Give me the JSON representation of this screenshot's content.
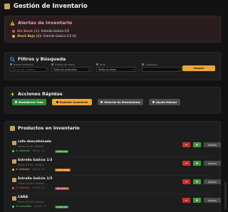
{
  "header": {
    "title": "Gestión de Inventario",
    "icon": "box-icon"
  },
  "alerts": {
    "title": "Alertas de Inventario",
    "items": [
      {
        "tag": "Sin Stock (1):",
        "text": "Estrella Galicia 1/5",
        "color": "#d9534f"
      },
      {
        "tag": "Stock Bajo (1):",
        "text": "Estrella Galicia 1/3 (4)",
        "color": "#f0ad4e"
      }
    ]
  },
  "filters": {
    "title": "Filtros y Búsqueda",
    "search_label": "Buscar producto",
    "search_placeholder": "Buscar por nombre...",
    "status_label": "Estado del stock",
    "status_value": "Todos los productos",
    "area_label": "Área",
    "area_value": "Todas las áreas",
    "category_label": "Categoría",
    "category_value": "",
    "clear_label": "Limpiar"
  },
  "actions": {
    "title": "Acciones Rápidas",
    "buttons": [
      {
        "label": "Restablecer Todo",
        "color": "#2e8b3a"
      },
      {
        "label": "Exportar Inventario",
        "color": "#f0a632"
      },
      {
        "label": "Historial de Movimientos",
        "color": "#4a4a4a"
      },
      {
        "label": "Ajuste Manual",
        "color": "#4a4a4a"
      }
    ]
  },
  "products": {
    "title": "Productos en Inventario",
    "items": [
      {
        "name": "cafe descafeinado",
        "meta": "Precio: €0.00 • Bebida",
        "stock": "0 unidades",
        "min": "Stock: 12",
        "badge": "STOCK OK",
        "badge_color": "#2e7d32",
        "minus": "−",
        "plus": "+",
        "adjust": "Ajustar"
      },
      {
        "name": "Estrella Galicia 1/3",
        "meta": "Precio: €0.00 • Alcohol",
        "stock": "4 unidades",
        "min": "Stock: 10",
        "badge": "STOCK BAJO",
        "badge_color": "#c77a00",
        "minus": "−",
        "plus": "+",
        "adjust": "Ajustar"
      },
      {
        "name": "Estrella Galicia 1/5",
        "meta": "Precio: €0.00 • Alcohol",
        "stock": "0 unidades",
        "min": "Stock: 10",
        "badge": "SIN STOCK",
        "badge_color": "#c9302c",
        "minus": "−",
        "plus": "+",
        "adjust": "Ajustar"
      },
      {
        "name": "CAÑA",
        "meta": "Precio: €0.00 • Alcohol",
        "stock": "10 unidades",
        "min": "Stock: 10",
        "badge": "STOCK OK",
        "badge_color": "#2e7d32",
        "minus": "−",
        "plus": "+",
        "adjust": "Ajustar"
      }
    ]
  }
}
